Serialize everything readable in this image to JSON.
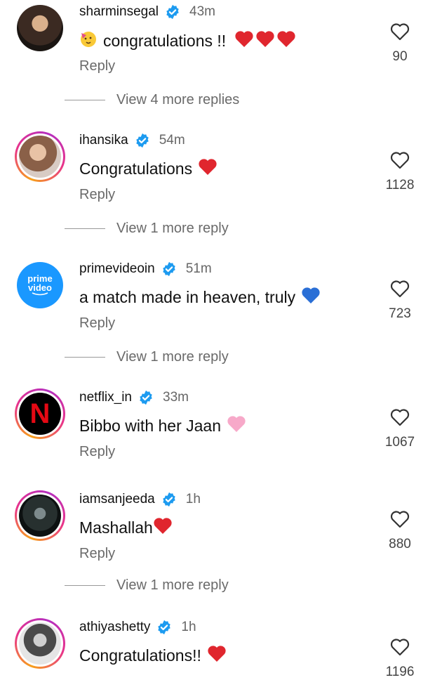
{
  "comments": [
    {
      "username": "sharminsegal",
      "time": "43m",
      "text": "congratulations !!",
      "reply": "Reply",
      "likes": "90",
      "more": "View 4 more replies",
      "avatar": "woman-portrait-dark",
      "emojis": [
        "party-face",
        "red-heart",
        "red-heart",
        "red-heart"
      ]
    },
    {
      "username": "ihansika",
      "time": "54m",
      "text": "Congratulations",
      "reply": "Reply",
      "likes": "1128",
      "more": "View 1 more reply",
      "avatar": "woman-portrait-light",
      "emojis": [
        "red-heart"
      ]
    },
    {
      "username": "primevideoin",
      "time": "51m",
      "text": "a match made in heaven, truly",
      "reply": "Reply",
      "likes": "723",
      "more": "View 1 more reply",
      "avatar": "prime-video-logo",
      "logo_text": [
        "prime",
        "video"
      ],
      "emojis": [
        "blue-heart"
      ]
    },
    {
      "username": "netflix_in",
      "time": "33m",
      "text": "Bibbo with her Jaan",
      "reply": "Reply",
      "likes": "1067",
      "more": "",
      "avatar": "netflix-logo",
      "logo_text": "N",
      "emojis": [
        "pink-heart"
      ]
    },
    {
      "username": "iamsanjeeda",
      "time": "1h",
      "text": "Mashallah",
      "reply": "Reply",
      "likes": "880",
      "more": "View 1 more reply",
      "avatar": "woman-portrait-dark",
      "emojis": [
        "red-heart"
      ]
    },
    {
      "username": "athiyashetty",
      "time": "1h",
      "text": "Congratulations!!",
      "reply": "",
      "likes": "1196",
      "more": "",
      "avatar": "woman-portrait-bw",
      "emojis": [
        "red-heart"
      ]
    }
  ],
  "colors": {
    "verified": "#1d9bf0",
    "prime": "#1a98ff",
    "netflix": "#e50914",
    "heart_red": "#e0262e",
    "heart_blue": "#2a6fd6",
    "heart_pink": "#f7a9c9"
  }
}
